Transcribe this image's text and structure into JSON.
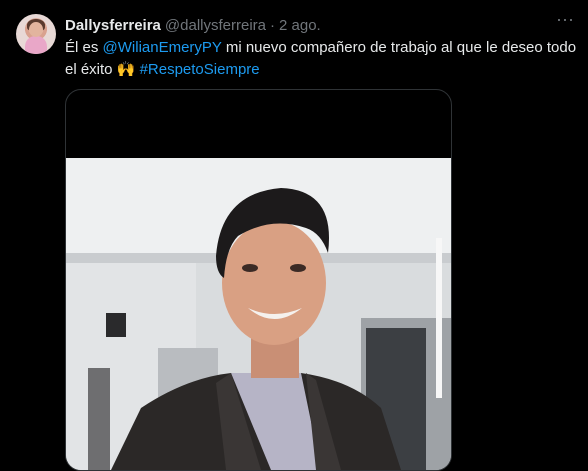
{
  "tweet": {
    "author_name": "Dallysferreira",
    "author_handle": "@dallysferreira",
    "separator": "·",
    "time": "2 ago.",
    "text_before": "Él es ",
    "mention": "@WilianEmeryPY",
    "text_middle": " mi nuevo compañero de trabajo al que le deseo todo el éxito ",
    "emoji": "🙌",
    "hashtag": "#RespetoSiempre"
  },
  "colors": {
    "background": "#000000",
    "text": "#e7e9ea",
    "secondary": "#71767b",
    "link": "#1d9bf0"
  },
  "icons": {
    "more": "more-dots-icon"
  }
}
